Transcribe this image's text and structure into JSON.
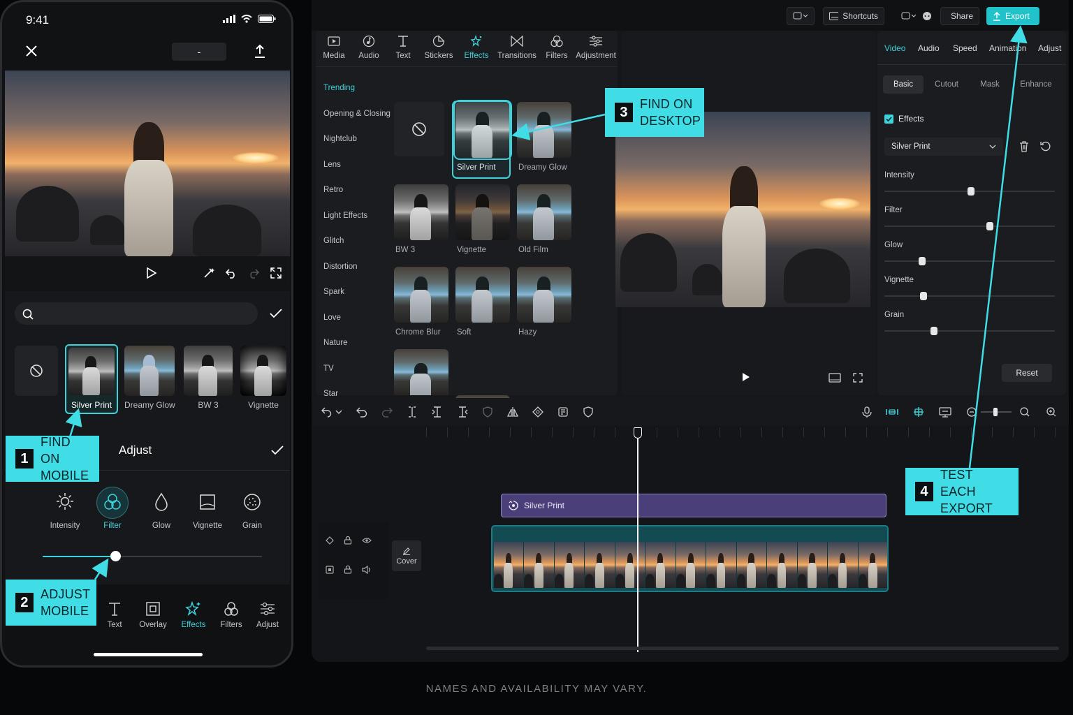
{
  "colors": {
    "accent": "#3fd2da",
    "callout": "#40dde6",
    "effect_clip": "#4b3f7a"
  },
  "mobile": {
    "time": "9:41",
    "title_field": "-",
    "search_placeholder": "",
    "effects": [
      {
        "label": "Silver Print",
        "selected": true
      },
      {
        "label": "Dreamy Glow",
        "selected": false
      },
      {
        "label": "BW 3",
        "selected": false
      },
      {
        "label": "Vignette",
        "selected": false
      }
    ],
    "adjust_title": "Adjust",
    "adjust_tools": [
      {
        "label": "Intensity",
        "icon": "sun-icon"
      },
      {
        "label": "Filter",
        "icon": "filter-circles-icon",
        "active": true
      },
      {
        "label": "Glow",
        "icon": "drop-icon"
      },
      {
        "label": "Vignette",
        "icon": "vignette-square-icon"
      },
      {
        "label": "Grain",
        "icon": "grain-icon"
      }
    ],
    "slider_value": 0.33,
    "bottom_nav": [
      {
        "label": "Text",
        "icon": "text-icon"
      },
      {
        "label": "Overlay",
        "icon": "overlay-icon"
      },
      {
        "label": "Effects",
        "icon": "effects-icon",
        "active": true
      },
      {
        "label": "Filters",
        "icon": "filters-icon"
      },
      {
        "label": "Adjust",
        "icon": "adjust-icon"
      }
    ]
  },
  "callouts": {
    "c1": {
      "num": "1",
      "line1": "FIND ON",
      "line2": "MOBILE"
    },
    "c2": {
      "num": "2",
      "line1": "ADJUST",
      "line2": "MOBILE"
    },
    "c3": {
      "num": "3",
      "line1": "FIND ON",
      "line2": "DESKTOP"
    },
    "c4": {
      "num": "4",
      "line1": "TEST EACH",
      "line2": "EXPORT"
    }
  },
  "desktop": {
    "top_buttons": {
      "shortcuts": "Shortcuts",
      "share": "Share",
      "export": "Export"
    },
    "toolbar": [
      {
        "label": "Media",
        "icon": "media-icon"
      },
      {
        "label": "Audio",
        "icon": "audio-icon"
      },
      {
        "label": "Text",
        "icon": "text-icon"
      },
      {
        "label": "Stickers",
        "icon": "stickers-icon"
      },
      {
        "label": "Effects",
        "icon": "effects-icon",
        "active": true
      },
      {
        "label": "Transitions",
        "icon": "transitions-icon"
      },
      {
        "label": "Filters",
        "icon": "filters-icon"
      },
      {
        "label": "Adjustment",
        "icon": "adjustment-icon"
      }
    ],
    "categories": [
      "Trending",
      "Opening & Closing",
      "Nightclub",
      "Lens",
      "Retro",
      "Light Effects",
      "Glitch",
      "Distortion",
      "Spark",
      "Love",
      "Nature",
      "TV",
      "Star"
    ],
    "effects": [
      "Silver Print",
      "Dreamy Glow",
      "BW 3",
      "Vignette",
      "Old Film",
      "Chrome Blur",
      "Soft",
      "Hazy"
    ],
    "right_tabs": [
      "Video",
      "Audio",
      "Speed",
      "Animation",
      "Adjust"
    ],
    "sub_tabs": [
      "Basic",
      "Cutout",
      "Mask",
      "Enhance"
    ],
    "effects_checkbox": "Effects",
    "effect_select": "Silver Print",
    "sliders": [
      {
        "label": "Intensity",
        "value": 0.51
      },
      {
        "label": "Filter",
        "value": 0.62
      },
      {
        "label": "Glow",
        "value": 0.22
      },
      {
        "label": "Vignette",
        "value": 0.23
      },
      {
        "label": "Grain",
        "value": 0.29
      }
    ],
    "reset": "Reset",
    "cover": "Cover",
    "effect_clip": "Silver Print"
  },
  "footer": "NAMES AND AVAILABILITY MAY VARY."
}
